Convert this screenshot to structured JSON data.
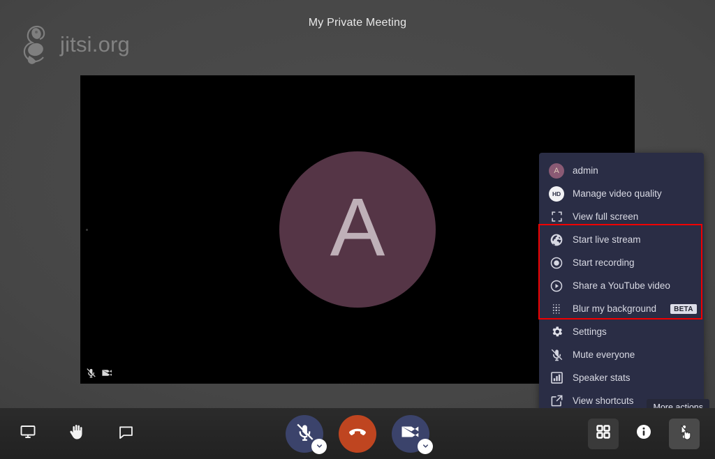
{
  "app": {
    "watermark_text": "jitsi.org",
    "watermark_icon": "jitsi-logo-icon",
    "subject": "My Private Meeting"
  },
  "stage": {
    "avatar_initial": "A",
    "avatar_color": "#553546",
    "background_color": "#000000",
    "indicators": [
      {
        "name": "microphone-muted-indicator-icon",
        "label": "Microphone muted"
      },
      {
        "name": "camera-muted-indicator-icon",
        "label": "Camera muted"
      }
    ]
  },
  "toolbar": {
    "left": [
      {
        "name": "share-screen-button",
        "icon": "monitor-icon",
        "label": "Share your screen"
      },
      {
        "name": "raise-hand-button",
        "icon": "raised-hand-icon",
        "label": "Raise your hand"
      },
      {
        "name": "chat-button",
        "icon": "chat-bubble-icon",
        "label": "Open chat"
      }
    ],
    "center": [
      {
        "name": "mute-audio-button",
        "icon": "microphone-muted-icon",
        "label": "Unmute",
        "has_dropdown": true,
        "color": "#3b436b"
      },
      {
        "name": "hangup-button",
        "icon": "phone-hangup-icon",
        "label": "Leave the meeting",
        "has_dropdown": false,
        "color": "#bf4520"
      },
      {
        "name": "mute-video-button",
        "icon": "camera-muted-icon",
        "label": "Start camera",
        "has_dropdown": true,
        "color": "#3b436b"
      }
    ],
    "right": [
      {
        "name": "tile-view-button",
        "icon": "tile-view-icon",
        "label": "Toggle tile view"
      },
      {
        "name": "info-button",
        "icon": "info-circle-icon",
        "label": "Meeting info"
      },
      {
        "name": "more-actions-button",
        "icon": "more-vertical-icon",
        "label": "More actions"
      }
    ]
  },
  "overflow_menu": {
    "background_color": "#2a2d45",
    "items": [
      {
        "name": "menu-item-profile",
        "icon": "avatar-icon",
        "label": "admin"
      },
      {
        "name": "menu-item-video-quality",
        "icon": "hd-badge-icon",
        "label": "Manage video quality"
      },
      {
        "name": "menu-item-full-screen",
        "icon": "fullscreen-icon",
        "label": "View full screen"
      },
      {
        "name": "menu-item-live-stream",
        "icon": "globe-icon",
        "label": "Start live stream"
      },
      {
        "name": "menu-item-recording",
        "icon": "record-circle-icon",
        "label": "Start recording"
      },
      {
        "name": "menu-item-share-youtube",
        "icon": "play-circle-icon",
        "label": "Share a YouTube video"
      },
      {
        "name": "menu-item-blur-background",
        "icon": "blur-dots-icon",
        "label": "Blur my background",
        "badge": "BETA"
      },
      {
        "name": "menu-item-settings",
        "icon": "gear-icon",
        "label": "Settings"
      },
      {
        "name": "menu-item-mute-everyone",
        "icon": "microphone-muted-icon",
        "label": "Mute everyone"
      },
      {
        "name": "menu-item-speaker-stats",
        "icon": "bar-chart-icon",
        "label": "Speaker stats"
      },
      {
        "name": "menu-item-view-shortcuts",
        "icon": "external-link-icon",
        "label": "View shortcuts"
      }
    ],
    "highlight": {
      "color": "#f00000",
      "from_item": "menu-item-live-stream",
      "to_item": "menu-item-blur-background"
    }
  },
  "tooltip": {
    "text": "More actions"
  }
}
